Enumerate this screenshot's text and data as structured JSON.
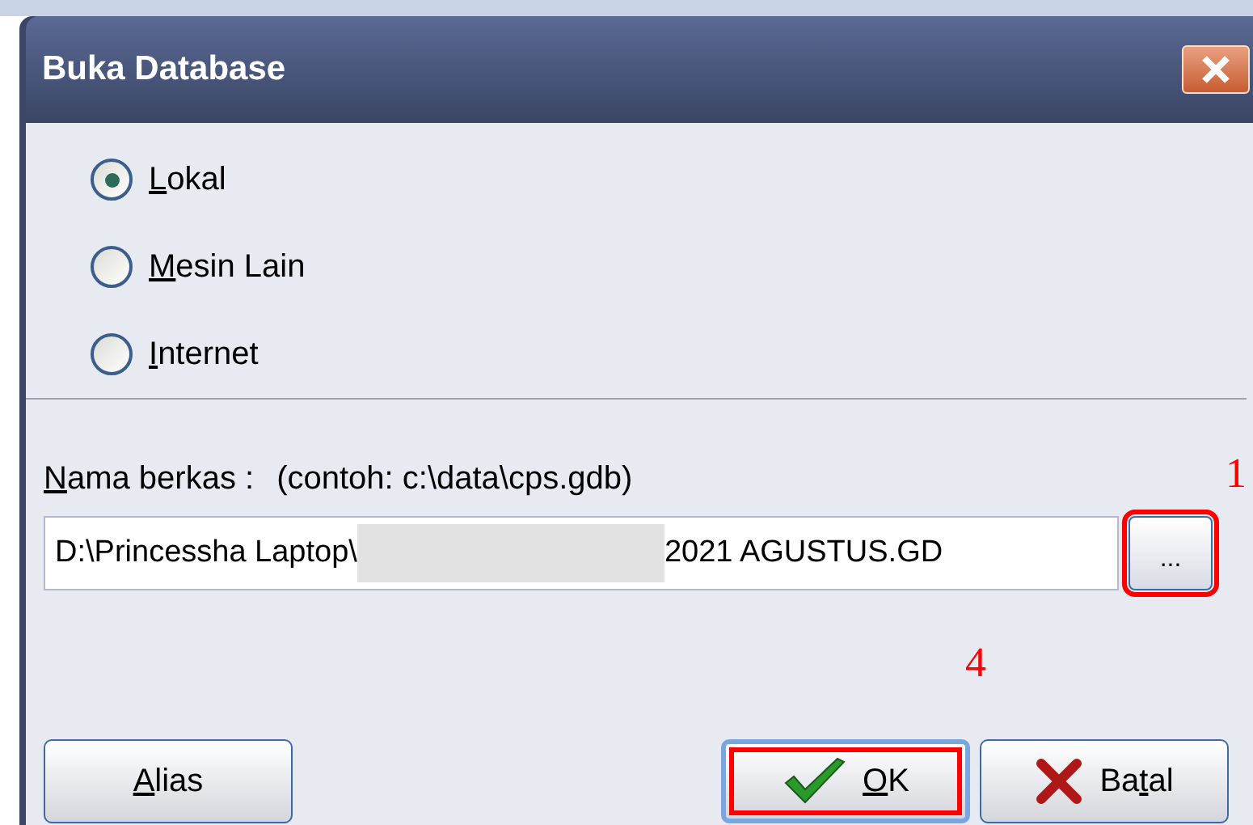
{
  "window": {
    "title": "Buka Database"
  },
  "options": [
    {
      "label_key": "L",
      "label_rest": "okal",
      "selected": true
    },
    {
      "label_key": "M",
      "label_rest": "esin Lain",
      "selected": false
    },
    {
      "label_key": "I",
      "label_rest": "nternet",
      "selected": false
    }
  ],
  "file": {
    "label_key": "N",
    "label_rest": "ama berkas :",
    "hint": "(contoh: c:\\data\\cps.gdb)",
    "value_start": "D:\\Princessha Laptop\\",
    "redacted": true,
    "value_end": "2021 AGUSTUS.GD",
    "browse": "...",
    "browse_annotation": "1"
  },
  "buttons": [
    {
      "kind": "plain",
      "label_key": "A",
      "label_rest": "lias",
      "default": false
    },
    {
      "kind": "ok",
      "label_key": "O",
      "label_rest": "K",
      "default": true,
      "annotation": "4"
    },
    {
      "kind": "cancel",
      "label_pre": "Ba",
      "label_key": "t",
      "label_rest": "al",
      "default": false
    }
  ]
}
